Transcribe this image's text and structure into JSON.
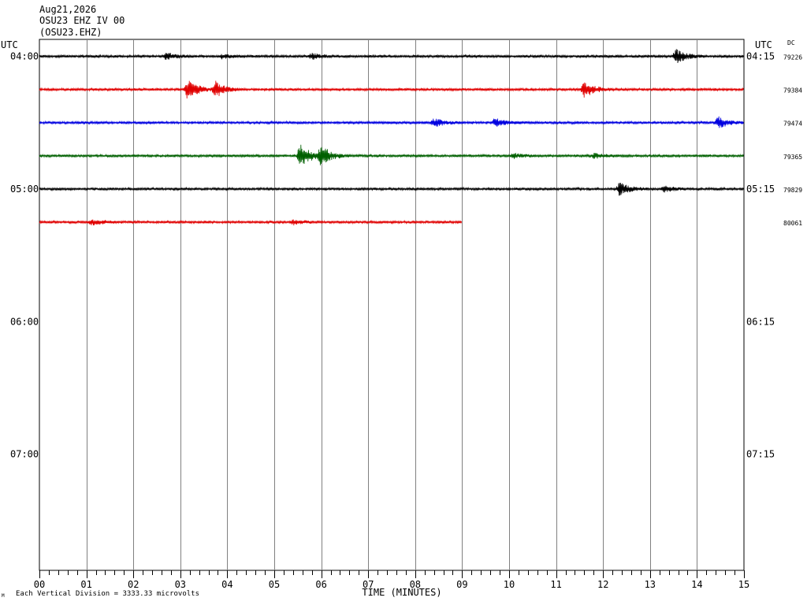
{
  "header": {
    "date": "Aug21,2026",
    "station": "OSU23 EHZ IV 00",
    "channel": "(OSU23.EHZ)"
  },
  "footer": {
    "mark": "M",
    "scale_note": "Each Vertical Division = 3333.33 microvolts"
  },
  "chart_data": {
    "type": "line",
    "title": "",
    "xlabel": "TIME (MINUTES)",
    "x_ticks": [
      "00",
      "01",
      "02",
      "03",
      "04",
      "05",
      "06",
      "07",
      "08",
      "09",
      "10",
      "11",
      "12",
      "13",
      "14",
      "15"
    ],
    "xlim": [
      0,
      15
    ],
    "grid": true,
    "left_axis_title": "UTC",
    "right_axis_title": "UTC",
    "dc_title": "DC",
    "left_hour_labels": [
      "04:00",
      "05:00",
      "06:00",
      "07:00"
    ],
    "right_hour_labels": [
      "04:15",
      "05:15",
      "06:15",
      "07:15"
    ],
    "trace_colors": [
      "#000000",
      "#e00000",
      "#0000e0",
      "#006000"
    ],
    "traces": [
      {
        "row": 0,
        "color": "#000000",
        "dc": "79226",
        "end_minute": 15,
        "events": [
          {
            "t": 2.7,
            "a": 4
          },
          {
            "t": 3.9,
            "a": 3
          },
          {
            "t": 5.8,
            "a": 4
          },
          {
            "t": 13.55,
            "a": 9
          }
        ]
      },
      {
        "row": 1,
        "color": "#e00000",
        "dc": "79384",
        "end_minute": 15,
        "events": [
          {
            "t": 3.15,
            "a": 13
          },
          {
            "t": 3.75,
            "a": 10
          },
          {
            "t": 11.6,
            "a": 10
          }
        ]
      },
      {
        "row": 2,
        "color": "#0000e0",
        "dc": "79474",
        "end_minute": 15,
        "events": [
          {
            "t": 8.4,
            "a": 5
          },
          {
            "t": 9.7,
            "a": 5
          },
          {
            "t": 14.45,
            "a": 7
          }
        ]
      },
      {
        "row": 3,
        "color": "#006000",
        "dc": "79365",
        "end_minute": 15,
        "events": [
          {
            "t": 5.55,
            "a": 16
          },
          {
            "t": 6.0,
            "a": 12
          },
          {
            "t": 10.1,
            "a": 3
          },
          {
            "t": 11.8,
            "a": 3
          }
        ]
      },
      {
        "row": 4,
        "color": "#000000",
        "dc": "79829",
        "end_minute": 15,
        "events": [
          {
            "t": 12.35,
            "a": 8
          },
          {
            "t": 13.3,
            "a": 4
          }
        ]
      },
      {
        "row": 5,
        "color": "#e00000",
        "dc": "80061",
        "end_minute": 9,
        "events": [
          {
            "t": 1.1,
            "a": 4
          },
          {
            "t": 5.4,
            "a": 3
          }
        ]
      }
    ]
  }
}
